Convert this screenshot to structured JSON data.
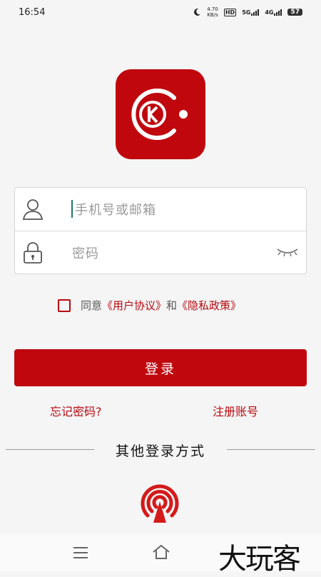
{
  "status_bar": {
    "time": "16:54",
    "net_speed_value": "4.70",
    "net_speed_unit": "KB/s",
    "hd_label": "HD",
    "network_5g": "5G",
    "network_4g": "4G",
    "battery": "57"
  },
  "login": {
    "account_placeholder": "手机号或邮箱",
    "password_placeholder": "密码"
  },
  "agreement": {
    "prefix": "同意",
    "user_agreement": "《用户协议》",
    "conjunction": "和",
    "privacy_policy": "《隐私政策》"
  },
  "actions": {
    "login_label": "登录",
    "forgot_password": "忘记密码?",
    "register": "注册账号"
  },
  "other_login": {
    "label": "其他登录方式"
  },
  "watermark": "大玩客",
  "colors": {
    "brand_red": "#c0070e",
    "link_red": "#b8080e"
  }
}
